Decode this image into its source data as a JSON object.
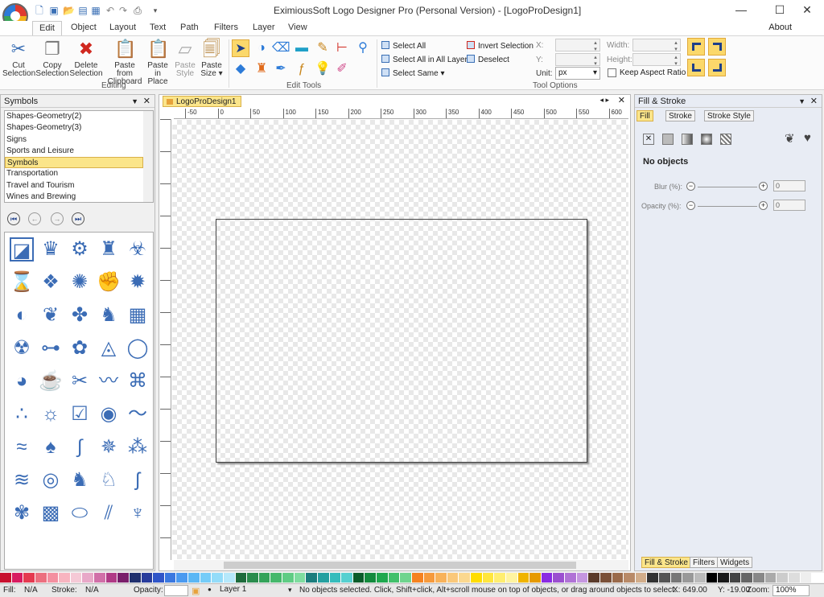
{
  "window": {
    "title": "EximiousSoft Logo Designer Pro (Personal Version) - [LogoProDesign1]",
    "minimize": "—",
    "maximize": "☐",
    "close": "✕"
  },
  "menu": {
    "tabs": [
      "Edit",
      "Object",
      "Layout",
      "Text",
      "Path",
      "Filters",
      "Layer",
      "View"
    ],
    "about": "About"
  },
  "ribbon": {
    "cut": "Cut\nSelection",
    "cut1": "Cut",
    "cut2": "Selection",
    "copy1": "Copy",
    "copy2": "Selection",
    "delete1": "Delete",
    "delete2": "Selection",
    "paste_clip1": "Paste from",
    "paste_clip2": "Clipboard",
    "paste_place1": "Paste in",
    "paste_place2": "Place",
    "paste_style1": "Paste",
    "paste_style2": "Style",
    "paste_size1": "Paste",
    "paste_size2": "Size ▾",
    "group_editing": "Editing",
    "group_edit_tools": "Edit Tools",
    "group_tool_options": "Tool Options",
    "select_all": "Select All",
    "select_all_layers": "Select All in All Layers",
    "select_same": "Select Same ▾",
    "invert_selection": "Invert Selection",
    "deselect": "Deselect",
    "x_label": "X:",
    "y_label": "Y:",
    "width_label": "Width:",
    "height_label": "Height:",
    "unit_label": "Unit:",
    "unit_value": "px",
    "keep_aspect": "Keep Aspect Ratio"
  },
  "symbols_panel": {
    "title": "Symbols",
    "categories": [
      "Shapes-Geometry(2)",
      "Shapes-Geometry(3)",
      "Signs",
      "Sports and Leisure",
      "Symbols",
      "Transportation",
      "Travel and Tourism",
      "Wines and Brewing"
    ],
    "selected": "Symbols"
  },
  "document": {
    "tab": "LogoProDesign1",
    "hruler_labels": [
      "-50",
      "0",
      "50",
      "100",
      "150",
      "200",
      "250",
      "300",
      "350",
      "400",
      "450",
      "500",
      "550",
      "600"
    ]
  },
  "fill_stroke_panel": {
    "title": "Fill & Stroke",
    "tabs": [
      "Fill",
      "Stroke",
      "Stroke Style"
    ],
    "no_objects": "No objects",
    "blur_label": "Blur (%):",
    "blur_value": "0",
    "opacity_label": "Opacity (%):",
    "opacity_value": "0",
    "bottom_tabs": [
      "Fill & Stroke",
      "Filters",
      "Widgets"
    ]
  },
  "status": {
    "fill_label": "Fill:",
    "fill_value": "N/A",
    "stroke_label": "Stroke:",
    "stroke_value": "N/A",
    "opacity_label": "Opacity:",
    "layer": "Layer 1",
    "message": "No objects selected. Click, Shift+click, Alt+scroll mouse on top of objects, or drag around objects to select.",
    "x": "X: 649.00",
    "y": "Y: -19.00",
    "zoom_label": "Zoom:",
    "zoom_value": "100%"
  },
  "palette": [
    "#c8102e",
    "#d81b60",
    "#e53950",
    "#ec6f7f",
    "#f48fa0",
    "#f8b4c0",
    "#f5c9d6",
    "#e8a8c8",
    "#d16fa8",
    "#b03a86",
    "#7a1f6b",
    "#20306e",
    "#283c9c",
    "#2f55c8",
    "#3a78e0",
    "#4a9af0",
    "#5bb7f5",
    "#74ccf8",
    "#93dcf9",
    "#b5e8fb",
    "#1e6b3c",
    "#2a8c4d",
    "#34a35a",
    "#46b86c",
    "#5fcc84",
    "#7edc9f",
    "#1b7d7d",
    "#25a0a0",
    "#35bcbc",
    "#56d0d0",
    "#0a5c2a",
    "#138a3d",
    "#1fa84e",
    "#42c06b",
    "#6fd48e",
    "#f58220",
    "#f69a3c",
    "#f8b25a",
    "#fac87a",
    "#fbd88f",
    "#ffdd00",
    "#ffe63d",
    "#ffee70",
    "#fff4a0",
    "#f0b400",
    "#e69a00",
    "#8a2be2",
    "#9b4fd0",
    "#b072d6",
    "#c596e0",
    "#5a3a2a",
    "#7a5038",
    "#9a6a4a",
    "#b88a68",
    "#d2ad8a",
    "#333333",
    "#555555",
    "#777777",
    "#999999",
    "#bbbbbb",
    "#000000",
    "#1a1a1a",
    "#444444",
    "#666666",
    "#888888",
    "#aaaaaa",
    "#cccccc",
    "#dddddd",
    "#eeeeee",
    "#ffffff"
  ]
}
